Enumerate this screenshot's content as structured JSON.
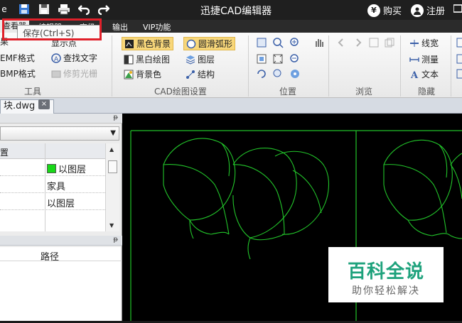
{
  "titlebar": {
    "app_title": "迅捷CAD编辑器",
    "buy_label": "购买",
    "register_label": "注册",
    "partial_left": "e"
  },
  "menubar": {
    "items": [
      "查看器",
      "编辑器",
      "高级",
      "输出",
      "VIP功能"
    ]
  },
  "tooltip": {
    "text": "保存(Ctrl+S)"
  },
  "ribbon": {
    "tools_group": {
      "label": "工具",
      "items": [
        "果",
        "EMF格式",
        "BMP格式",
        "显示点",
        "查找文字",
        "修剪光栅"
      ]
    },
    "cad_settings_group": {
      "label": "CAD绘图设置",
      "items": [
        "黑色背景",
        "黑白绘图",
        "背景色",
        "圆滑弧形",
        "图层",
        "结构"
      ]
    },
    "position_group": {
      "label": "位置"
    },
    "browse_group": {
      "label": "浏览"
    },
    "hide_group": {
      "label": "隐藏",
      "items": [
        "线宽",
        "测量",
        "文本"
      ]
    }
  },
  "document_tab": {
    "label": "块.dwg",
    "close": "×"
  },
  "properties_panel": {
    "header_label": "置",
    "rows": [
      {
        "value": "以图层",
        "swatch": "#18d818"
      },
      {
        "value": "家具"
      },
      {
        "value": "以图层"
      }
    ]
  },
  "files_panel": {
    "column_path": "路径"
  },
  "watermark": {
    "title": "百科全说",
    "subtitle": "助你轻松解决"
  },
  "colors": {
    "titlebar_bg": "#1f1f1f",
    "canvas_bg": "#000000",
    "drawing_line": "#22c42a",
    "watermark_green": "#1ea27c",
    "tooltip_highlight": "#e0202a",
    "ribbon_selected": "#f8d77a"
  }
}
